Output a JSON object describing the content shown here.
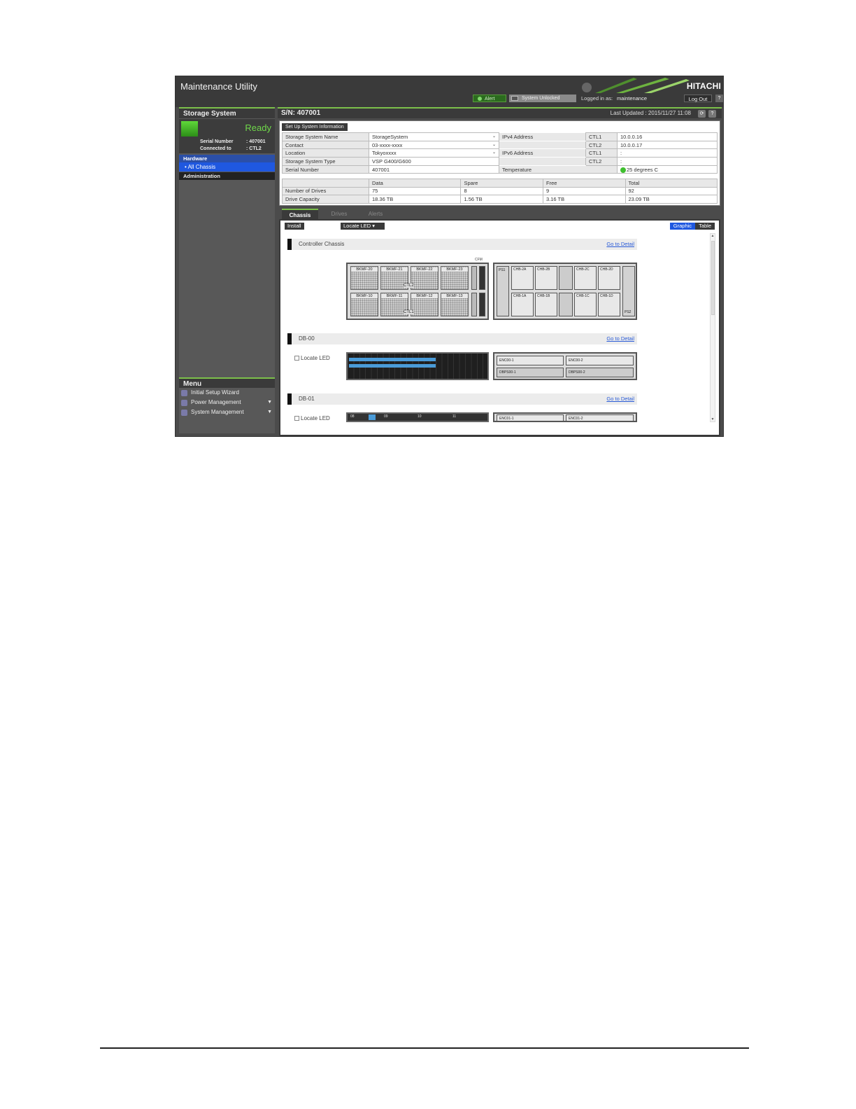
{
  "header": {
    "app_title": "Maintenance Utility",
    "brand": "HITACHI",
    "alert_label": "Alert",
    "lock_label": "System Unlocked",
    "logged_in_label": "Logged in as:",
    "logged_in_user": "maintenance",
    "logout_label": "Log Out",
    "help_label": "?"
  },
  "sidebar": {
    "title": "Storage System",
    "status": "Ready",
    "serial_label": "Serial Number",
    "serial_value": ": 407001",
    "connected_label": "Connected to",
    "connected_value": ": CTL2",
    "nav": {
      "hardware": "Hardware",
      "all_chassis": "All Chassis",
      "administration": "Administration"
    },
    "menu_title": "Menu",
    "menu_items": [
      "Initial Setup Wizard",
      "Power Management",
      "System Management"
    ]
  },
  "main": {
    "sn_title": "S/N: 407001",
    "last_updated": "Last Updated : 2015/11/27 11:08",
    "setup_button": "Set Up System Information",
    "info": {
      "name_label": "Storage System Name",
      "name_value": "StorageSystem",
      "contact_label": "Contact",
      "contact_value": "03-xxxx-xxxx",
      "location_label": "Location",
      "location_value": "Tokyoxxxx",
      "type_label": "Storage System Type",
      "type_value": "VSP G400/G600",
      "serial_label": "Serial Number",
      "serial_value": "407001",
      "ipv4_label": "IPv4 Address",
      "ipv6_label": "IPv6 Address",
      "ctl1": "CTL1",
      "ctl2": "CTL2",
      "ipv4_ctl1": "10.0.0.16",
      "ipv4_ctl2": "10.0.0.17",
      "ipv6_ctl1": ":",
      "ipv6_ctl2": ":",
      "temp_label": "Temperature",
      "temp_value": "25 degrees C"
    },
    "capacity": {
      "headers": [
        "Data",
        "Spare",
        "Free",
        "Total"
      ],
      "rows": [
        {
          "label": "Number of Drives",
          "values": [
            "75",
            "8",
            "9",
            "92"
          ]
        },
        {
          "label": "Drive Capacity",
          "values": [
            "18.36 TB",
            "1.56 TB",
            "3.16 TB",
            "23.09 TB"
          ]
        }
      ]
    },
    "tabs": [
      "Chassis",
      "Drives",
      "Alerts"
    ],
    "toolbar": {
      "install": "Install",
      "locate_led": "Locate LED",
      "graphic": "Graphic",
      "table": "Table"
    },
    "sections": [
      {
        "name": "Controller Chassis",
        "link": "Go to Detail"
      },
      {
        "name": "DB-00",
        "link": "Go to Detail",
        "locate": "Locate LED"
      },
      {
        "name": "DB-01",
        "link": "Go to Detail",
        "locate": "Locate LED"
      }
    ],
    "controller": {
      "cfm": "CFM",
      "bays_top": [
        "BKMF-20",
        "BKMF-21",
        "BKMF-22",
        "BKMF-23"
      ],
      "bays_bottom": [
        "BKMF-10",
        "BKMF-11",
        "BKMF-12",
        "BKMF-13"
      ],
      "ctl_top": "CTL2",
      "ctl_bottom": "CTL1",
      "ps1": "PS1",
      "ps2": "PS2",
      "chb_top": [
        "CHB-2A",
        "CHB-2B",
        "CHB-2C",
        "CHB-2D"
      ],
      "chb_bottom": [
        "CHB-1A",
        "CHB-1B",
        "CHB-1C",
        "CHB-1D"
      ]
    },
    "db00": {
      "enc1": "ENC00-1",
      "enc2": "ENC00-2",
      "dbps1": "DBPS00-1",
      "dbps2": "DBPS00-2"
    },
    "db01": {
      "enc1": "ENC01-1",
      "enc2": "ENC01-2",
      "slots": [
        "08",
        "09",
        "10",
        "11"
      ]
    }
  }
}
